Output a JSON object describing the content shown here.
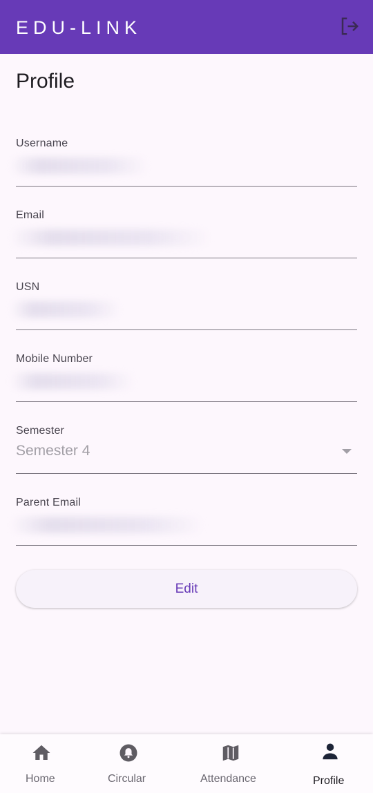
{
  "app": {
    "title": "EDU-LINK",
    "logout_icon": "logout-icon"
  },
  "page": {
    "title": "Profile"
  },
  "fields": {
    "username": {
      "label": "Username",
      "value": ""
    },
    "email": {
      "label": "Email",
      "value": ""
    },
    "usn": {
      "label": "USN",
      "value": ""
    },
    "mobile": {
      "label": "Mobile Number",
      "value": ""
    },
    "semester": {
      "label": "Semester",
      "value": "Semester 4"
    },
    "parent_email": {
      "label": "Parent Email",
      "value": ""
    }
  },
  "actions": {
    "edit_label": "Edit"
  },
  "nav": {
    "items": [
      {
        "label": "Home",
        "icon": "home-icon"
      },
      {
        "label": "Circular",
        "icon": "bell-icon"
      },
      {
        "label": "Attendance",
        "icon": "map-icon"
      },
      {
        "label": "Profile",
        "icon": "person-icon",
        "active": true
      }
    ]
  },
  "colors": {
    "primary": "#673ab7",
    "background": "#fdf7fd",
    "icon": "#5f5c63",
    "active_icon": "#1d2437"
  }
}
